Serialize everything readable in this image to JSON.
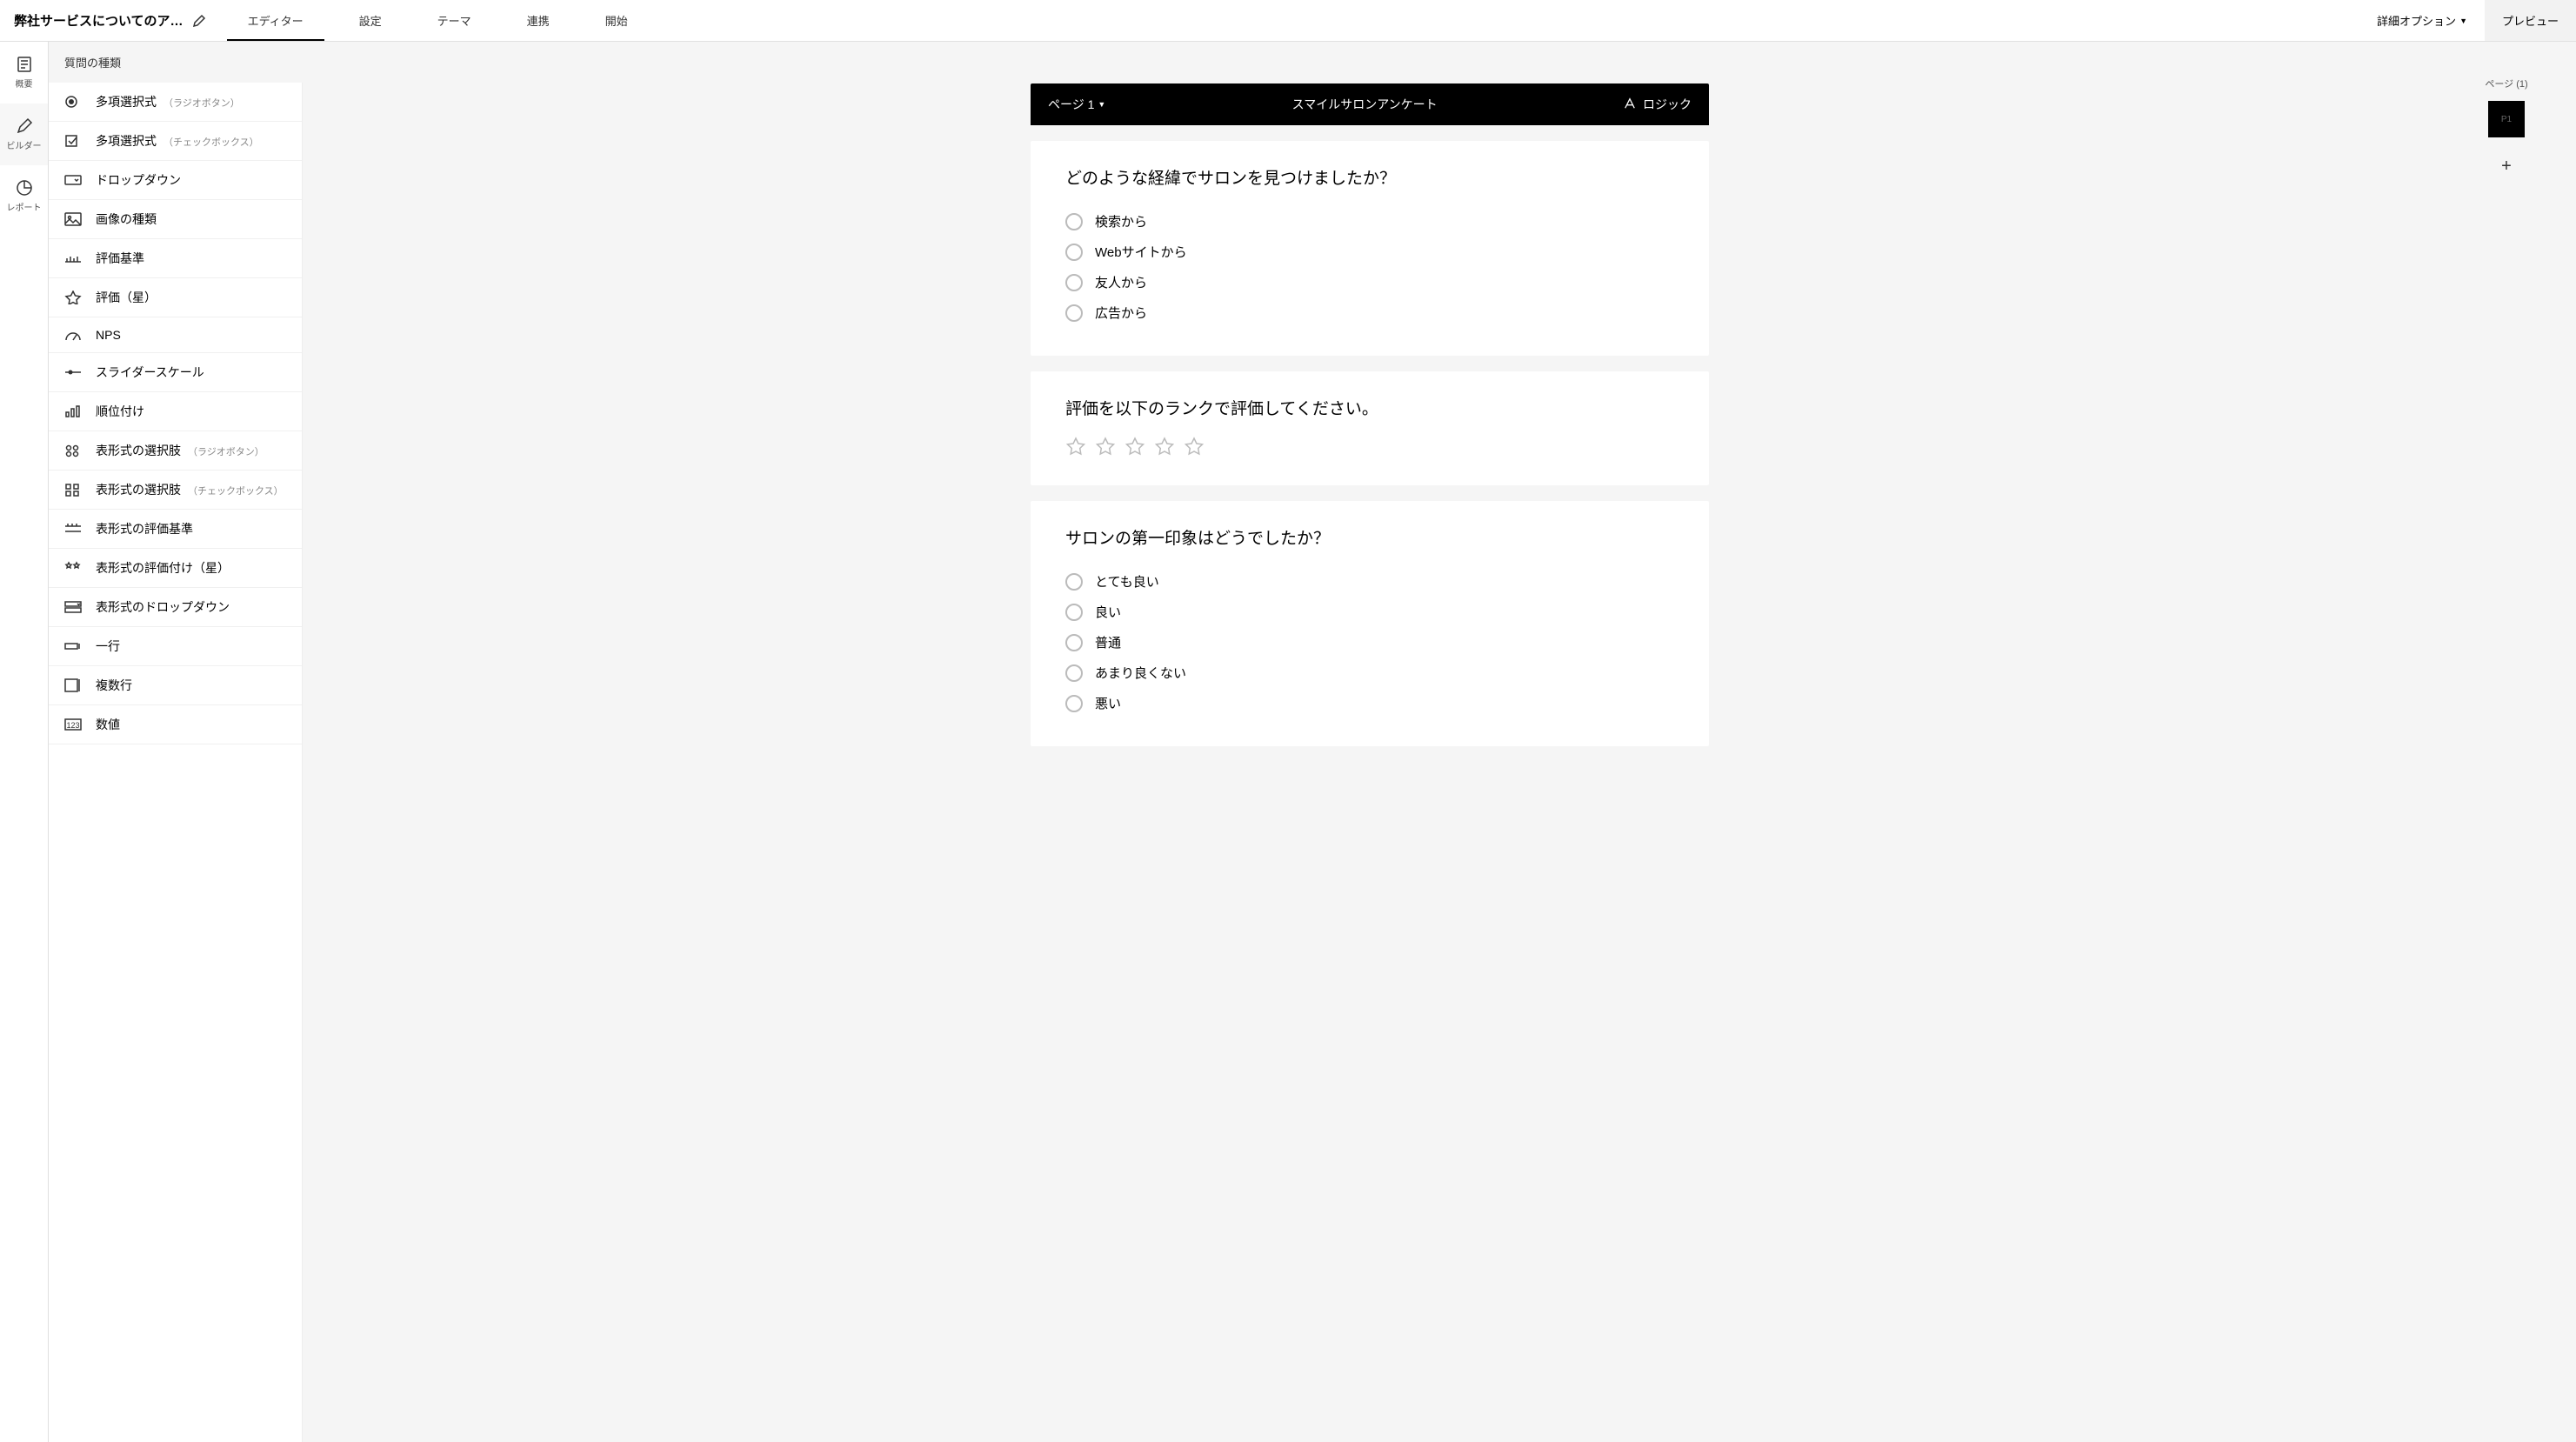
{
  "header": {
    "survey_title": "弊社サービスについてのア…",
    "tabs": [
      "エディター",
      "設定",
      "テーマ",
      "連携",
      "開始"
    ],
    "active_tab_index": 0,
    "advanced_options": "詳細オプション",
    "preview": "プレビュー"
  },
  "rail": {
    "items": [
      {
        "label": "概要",
        "icon": "overview"
      },
      {
        "label": "ビルダー",
        "icon": "builder"
      },
      {
        "label": "レポート",
        "icon": "report"
      }
    ],
    "active_index": 1
  },
  "qtypes": {
    "header": "質問の種類",
    "items": [
      {
        "icon": "radio",
        "label": "多項選択式",
        "sub": "（ラジオボタン）"
      },
      {
        "icon": "checkbox",
        "label": "多項選択式",
        "sub": "（チェックボックス）"
      },
      {
        "icon": "dropdown",
        "label": "ドロップダウン",
        "sub": ""
      },
      {
        "icon": "image",
        "label": "画像の種類",
        "sub": ""
      },
      {
        "icon": "scale-h",
        "label": "評価基準",
        "sub": ""
      },
      {
        "icon": "star",
        "label": "評価（星）",
        "sub": ""
      },
      {
        "icon": "nps",
        "label": "NPS",
        "sub": ""
      },
      {
        "icon": "slider",
        "label": "スライダースケール",
        "sub": ""
      },
      {
        "icon": "ranking",
        "label": "順位付け",
        "sub": ""
      },
      {
        "icon": "matrix-radio",
        "label": "表形式の選択肢",
        "sub": "（ラジオボタン）"
      },
      {
        "icon": "matrix-check",
        "label": "表形式の選択肢",
        "sub": "（チェックボックス）"
      },
      {
        "icon": "matrix-scale",
        "label": "表形式の評価基準",
        "sub": ""
      },
      {
        "icon": "matrix-star",
        "label": "表形式の評価付け（星）",
        "sub": ""
      },
      {
        "icon": "matrix-dropdown",
        "label": "表形式のドロップダウン",
        "sub": ""
      },
      {
        "icon": "single-line",
        "label": "一行",
        "sub": ""
      },
      {
        "icon": "multi-line",
        "label": "複数行",
        "sub": ""
      },
      {
        "icon": "number",
        "label": "数値",
        "sub": ""
      }
    ]
  },
  "canvas": {
    "page_label": "ページ 1",
    "survey_name": "スマイルサロンアンケート",
    "logic_label": "ロジック",
    "questions": [
      {
        "title": "どのような経緯でサロンを見つけましたか？",
        "type": "radio",
        "options": [
          "検索から",
          "Webサイトから",
          "友人から",
          "広告から"
        ]
      },
      {
        "title": "評価を以下のランクで評価してください。",
        "type": "star",
        "star_count": 5
      },
      {
        "title": "サロンの第一印象はどうでしたか？",
        "type": "radio",
        "options": [
          "とても良い",
          "良い",
          "普通",
          "あまり良くない",
          "悪い"
        ]
      }
    ]
  },
  "page_panel": {
    "title": "ページ (1)",
    "thumb_label": "P1"
  }
}
